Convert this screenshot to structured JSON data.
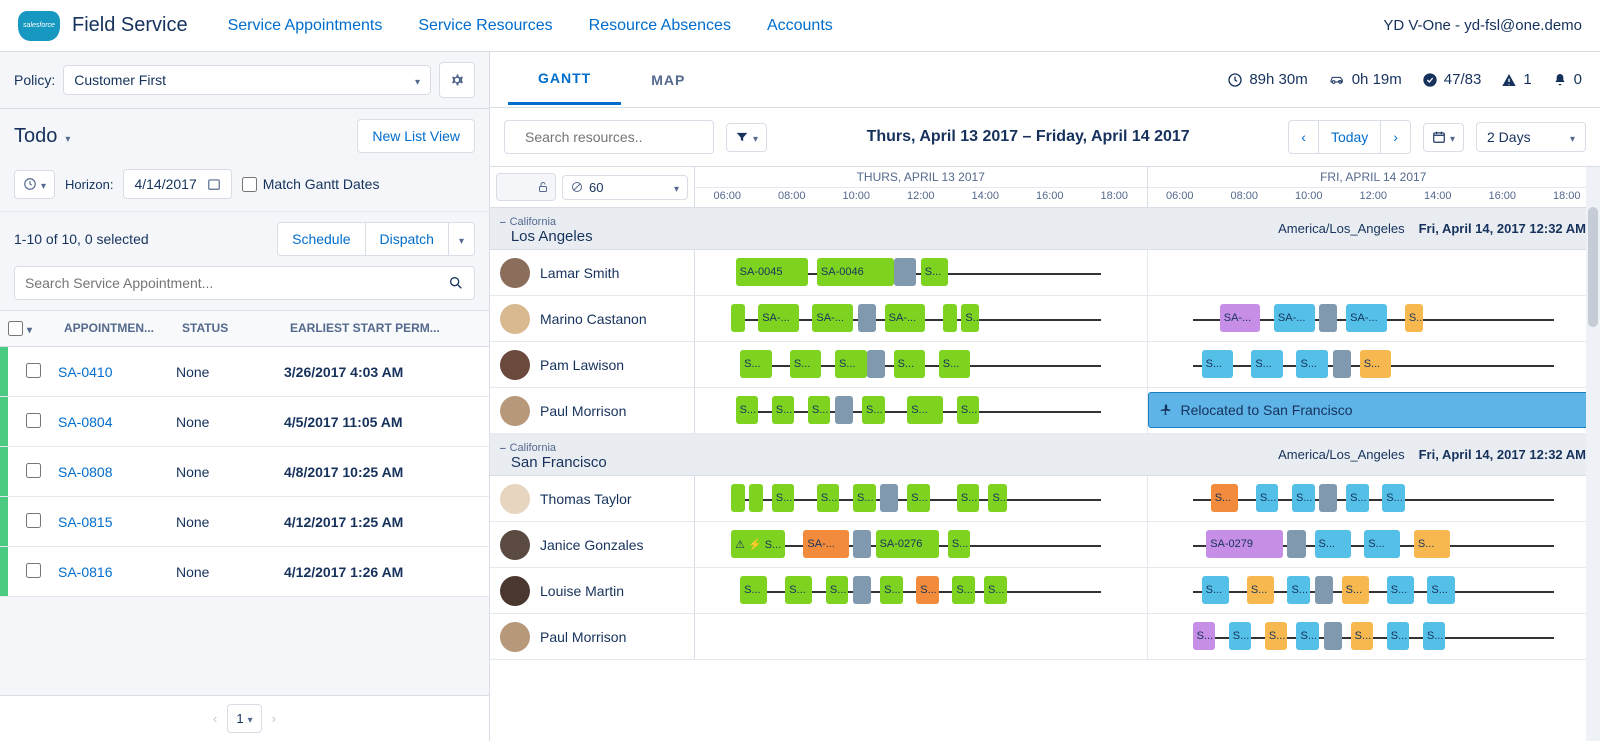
{
  "app_title": "Field Service",
  "topnav": [
    "Service Appointments",
    "Service Resources",
    "Resource Absences",
    "Accounts"
  ],
  "user_info": "YD V-One - yd-fsl@one.demo",
  "policy": {
    "label": "Policy:",
    "value": "Customer First"
  },
  "list": {
    "title": "Todo",
    "new_view": "New List View"
  },
  "horizon": {
    "label": "Horizon:",
    "date": "4/14/2017",
    "match": "Match Gantt Dates"
  },
  "count_text": "1-10 of 10, 0 selected",
  "action_buttons": {
    "schedule": "Schedule",
    "dispatch": "Dispatch"
  },
  "search_placeholder": "Search Service Appointment...",
  "columns": {
    "appt": "APPOINTMEN...",
    "status": "STATUS",
    "early": "EARLIEST START PERM..."
  },
  "rows": [
    {
      "id": "SA-0410",
      "status": "None",
      "early": "3/26/2017 4:03 AM"
    },
    {
      "id": "SA-0804",
      "status": "None",
      "early": "4/5/2017 11:05 AM"
    },
    {
      "id": "SA-0808",
      "status": "None",
      "early": "4/8/2017 10:25 AM"
    },
    {
      "id": "SA-0815",
      "status": "None",
      "early": "4/12/2017 1:25 AM"
    },
    {
      "id": "SA-0816",
      "status": "None",
      "early": "4/12/2017 1:26 AM"
    }
  ],
  "page_num": "1",
  "tabs": {
    "gantt": "GANTT",
    "map": "MAP"
  },
  "stats": {
    "hours": "89h 30m",
    "drive": "0h 19m",
    "done": "47/83",
    "warn": "1",
    "bell": "0"
  },
  "search_res_placeholder": "Search resources..",
  "date_range": "Thurs, April 13 2017 – Friday, April 14 2017",
  "today_btn": "Today",
  "view_range": "2 Days",
  "zoom": "60",
  "day_headers": [
    "THURS, APRIL 13 2017",
    "FRI, APRIL 14 2017"
  ],
  "hours": [
    "06:00",
    "08:00",
    "10:00",
    "12:00",
    "14:00",
    "16:00",
    "18:00"
  ],
  "territories": [
    {
      "state": "California",
      "city": "Los Angeles",
      "tz": "America/Los_Angeles",
      "ts": "Fri, April 14, 2017 12:32 AM",
      "resources": [
        {
          "name": "Lamar Smith",
          "avatar": "#8a6d5a",
          "day1": [
            {
              "l": 9,
              "w": 16,
              "c": "green",
              "t": "SA-0045"
            },
            {
              "l": 27,
              "w": 17,
              "c": "green",
              "t": "SA-0046"
            },
            {
              "l": 44,
              "w": 5,
              "c": "grey",
              "t": ""
            },
            {
              "l": 50,
              "w": 6,
              "c": "green",
              "t": "S..."
            }
          ],
          "day2": []
        },
        {
          "name": "Marino Castanon",
          "avatar": "#d9b98f",
          "day1": [
            {
              "l": 8,
              "w": 3,
              "c": "green",
              "t": ""
            },
            {
              "l": 14,
              "w": 9,
              "c": "green",
              "t": "SA-..."
            },
            {
              "l": 26,
              "w": 9,
              "c": "green",
              "t": "SA-..."
            },
            {
              "l": 36,
              "w": 4,
              "c": "grey",
              "t": ""
            },
            {
              "l": 42,
              "w": 9,
              "c": "green",
              "t": "SA-..."
            },
            {
              "l": 55,
              "w": 3,
              "c": "green",
              "t": ""
            },
            {
              "l": 59,
              "w": 4,
              "c": "green",
              "t": "S..."
            }
          ],
          "day2": [
            {
              "l": 16,
              "w": 9,
              "c": "purple",
              "t": "SA-..."
            },
            {
              "l": 28,
              "w": 9,
              "c": "blue",
              "t": "SA-..."
            },
            {
              "l": 38,
              "w": 4,
              "c": "grey",
              "t": ""
            },
            {
              "l": 44,
              "w": 9,
              "c": "blue",
              "t": "SA-..."
            },
            {
              "l": 57,
              "w": 4,
              "c": "orange",
              "t": "S..."
            }
          ]
        },
        {
          "name": "Pam Lawison",
          "avatar": "#6b4a3d",
          "day1": [
            {
              "l": 10,
              "w": 7,
              "c": "green",
              "t": "S..."
            },
            {
              "l": 21,
              "w": 7,
              "c": "green",
              "t": "S..."
            },
            {
              "l": 31,
              "w": 7,
              "c": "green",
              "t": "S..."
            },
            {
              "l": 38,
              "w": 4,
              "c": "grey",
              "t": ""
            },
            {
              "l": 44,
              "w": 7,
              "c": "green",
              "t": "S..."
            },
            {
              "l": 54,
              "w": 7,
              "c": "green",
              "t": "S..."
            }
          ],
          "day2": [
            {
              "l": 12,
              "w": 7,
              "c": "blue",
              "t": "S..."
            },
            {
              "l": 23,
              "w": 7,
              "c": "blue",
              "t": "S..."
            },
            {
              "l": 33,
              "w": 7,
              "c": "blue",
              "t": "S..."
            },
            {
              "l": 41,
              "w": 4,
              "c": "grey",
              "t": ""
            },
            {
              "l": 47,
              "w": 7,
              "c": "orange",
              "t": "S..."
            }
          ]
        },
        {
          "name": "Paul Morrison",
          "avatar": "#b8987a",
          "day1": [
            {
              "l": 9,
              "w": 5,
              "c": "green",
              "t": "S..."
            },
            {
              "l": 17,
              "w": 5,
              "c": "green",
              "t": "S..."
            },
            {
              "l": 25,
              "w": 5,
              "c": "green",
              "t": "S..."
            },
            {
              "l": 31,
              "w": 4,
              "c": "grey",
              "t": ""
            },
            {
              "l": 37,
              "w": 5,
              "c": "green",
              "t": "S..."
            },
            {
              "l": 47,
              "w": 8,
              "c": "green",
              "t": "S..."
            },
            {
              "l": 58,
              "w": 5,
              "c": "green",
              "t": "S..."
            }
          ],
          "day2_relocated": true,
          "relocated_text": "Relocated to San Francisco"
        }
      ]
    },
    {
      "state": "California",
      "city": "San Francisco",
      "tz": "America/Los_Angeles",
      "ts": "Fri, April 14, 2017 12:32 AM",
      "resources": [
        {
          "name": "Thomas Taylor",
          "avatar": "#e8d5c0",
          "day1": [
            {
              "l": 8,
              "w": 3,
              "c": "green",
              "t": ""
            },
            {
              "l": 12,
              "w": 3,
              "c": "green",
              "t": ""
            },
            {
              "l": 17,
              "w": 5,
              "c": "green",
              "t": "S..."
            },
            {
              "l": 27,
              "w": 5,
              "c": "green",
              "t": "S..."
            },
            {
              "l": 35,
              "w": 5,
              "c": "green",
              "t": "S..."
            },
            {
              "l": 41,
              "w": 4,
              "c": "grey",
              "t": ""
            },
            {
              "l": 47,
              "w": 5,
              "c": "green",
              "t": "S..."
            },
            {
              "l": 58,
              "w": 5,
              "c": "green",
              "t": "S..."
            },
            {
              "l": 65,
              "w": 4,
              "c": "green",
              "t": "S..."
            }
          ],
          "day2": [
            {
              "l": 14,
              "w": 6,
              "c": "dorange",
              "t": "S..."
            },
            {
              "l": 24,
              "w": 5,
              "c": "blue",
              "t": "S..."
            },
            {
              "l": 32,
              "w": 5,
              "c": "blue",
              "t": "S..."
            },
            {
              "l": 38,
              "w": 4,
              "c": "grey",
              "t": ""
            },
            {
              "l": 44,
              "w": 5,
              "c": "blue",
              "t": "S..."
            },
            {
              "l": 52,
              "w": 5,
              "c": "blue",
              "t": "S..."
            }
          ]
        },
        {
          "name": "Janice Gonzales",
          "avatar": "#5a4a42",
          "day1": [
            {
              "l": 8,
              "w": 12,
              "c": "green",
              "t": "⚠ ⚡ S..."
            },
            {
              "l": 24,
              "w": 10,
              "c": "dorange",
              "t": "SA-..."
            },
            {
              "l": 35,
              "w": 4,
              "c": "grey",
              "t": ""
            },
            {
              "l": 40,
              "w": 14,
              "c": "green",
              "t": "SA-0276"
            },
            {
              "l": 56,
              "w": 5,
              "c": "green",
              "t": "S..."
            }
          ],
          "day2": [
            {
              "l": 13,
              "w": 17,
              "c": "purple",
              "t": "SA-0279"
            },
            {
              "l": 31,
              "w": 4,
              "c": "grey",
              "t": ""
            },
            {
              "l": 37,
              "w": 8,
              "c": "blue",
              "t": "S..."
            },
            {
              "l": 48,
              "w": 8,
              "c": "blue",
              "t": "S..."
            },
            {
              "l": 59,
              "w": 8,
              "c": "orange",
              "t": "S..."
            }
          ]
        },
        {
          "name": "Louise Martin",
          "avatar": "#4a3830",
          "day1": [
            {
              "l": 10,
              "w": 6,
              "c": "green",
              "t": "S..."
            },
            {
              "l": 20,
              "w": 6,
              "c": "green",
              "t": "S..."
            },
            {
              "l": 29,
              "w": 5,
              "c": "green",
              "t": "S..."
            },
            {
              "l": 35,
              "w": 4,
              "c": "grey",
              "t": ""
            },
            {
              "l": 41,
              "w": 5,
              "c": "green",
              "t": "S..."
            },
            {
              "l": 49,
              "w": 5,
              "c": "dorange",
              "t": "S..."
            },
            {
              "l": 57,
              "w": 5,
              "c": "green",
              "t": "S..."
            },
            {
              "l": 64,
              "w": 5,
              "c": "green",
              "t": "S..."
            }
          ],
          "day2": [
            {
              "l": 12,
              "w": 6,
              "c": "blue",
              "t": "S..."
            },
            {
              "l": 22,
              "w": 6,
              "c": "orange",
              "t": "S..."
            },
            {
              "l": 31,
              "w": 5,
              "c": "blue",
              "t": "S..."
            },
            {
              "l": 37,
              "w": 4,
              "c": "grey",
              "t": ""
            },
            {
              "l": 43,
              "w": 6,
              "c": "orange",
              "t": "S..."
            },
            {
              "l": 53,
              "w": 6,
              "c": "blue",
              "t": "S..."
            },
            {
              "l": 62,
              "w": 6,
              "c": "blue",
              "t": "S..."
            }
          ]
        },
        {
          "name": "Paul Morrison",
          "avatar": "#b8987a",
          "day1": [],
          "day2": [
            {
              "l": 10,
              "w": 5,
              "c": "purple",
              "t": "S..."
            },
            {
              "l": 18,
              "w": 5,
              "c": "blue",
              "t": "S..."
            },
            {
              "l": 26,
              "w": 5,
              "c": "orange",
              "t": "S..."
            },
            {
              "l": 33,
              "w": 5,
              "c": "blue",
              "t": "S..."
            },
            {
              "l": 39,
              "w": 4,
              "c": "grey",
              "t": ""
            },
            {
              "l": 45,
              "w": 5,
              "c": "orange",
              "t": "S..."
            },
            {
              "l": 53,
              "w": 5,
              "c": "blue",
              "t": "S..."
            },
            {
              "l": 61,
              "w": 5,
              "c": "blue",
              "t": "S..."
            }
          ]
        }
      ]
    }
  ]
}
